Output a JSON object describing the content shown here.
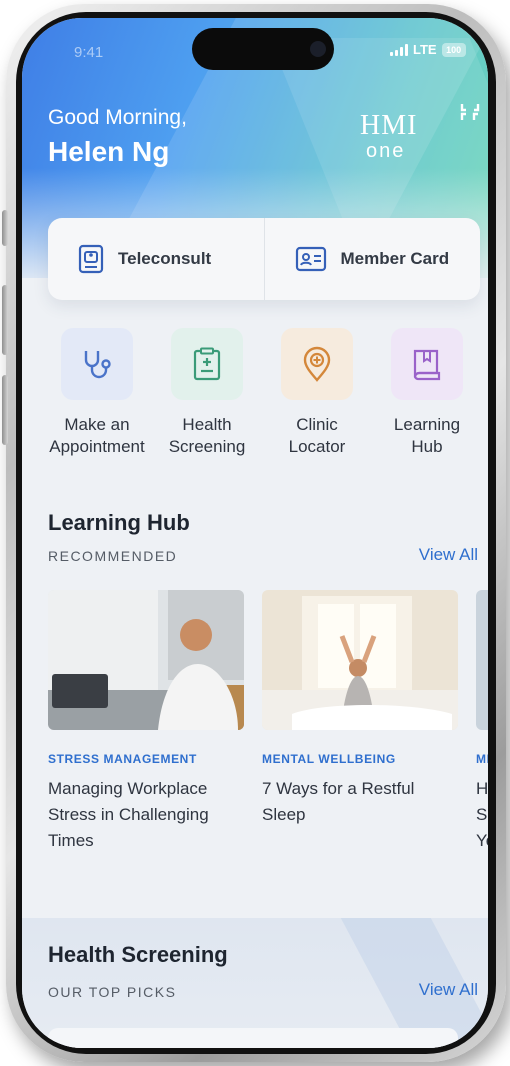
{
  "status_bar": {
    "time": "9:41",
    "network": "LTE",
    "battery": "100"
  },
  "header": {
    "greeting": "Good Morning,",
    "user_name": "Helen Ng",
    "logo_main": "HMI",
    "logo_sub": "one"
  },
  "quick_actions": [
    {
      "label": "Teleconsult",
      "icon": "badge-id-icon"
    },
    {
      "label": "Member Card",
      "icon": "member-card-icon"
    }
  ],
  "services": [
    {
      "label": "Make an\nAppointment",
      "icon": "stethoscope-icon",
      "tile_color": "#e3e9f7",
      "icon_color": "#4a73c9"
    },
    {
      "label": "Health\nScreening",
      "icon": "clipboard-icon",
      "tile_color": "#e2f1ec",
      "icon_color": "#3a9b78"
    },
    {
      "label": "Clinic\nLocator",
      "icon": "location-pin-icon",
      "tile_color": "#f6ebde",
      "icon_color": "#d4873a"
    },
    {
      "label": "Learning\nHub",
      "icon": "book-icon",
      "tile_color": "#efe6f7",
      "icon_color": "#9a62c9"
    }
  ],
  "learning_hub": {
    "title": "Learning Hub",
    "subtitle": "RECOMMENDED",
    "view_all": "View All",
    "articles": [
      {
        "category": "STRESS MANAGEMENT",
        "title": "Managing Workplace Stress in Challenging Times"
      },
      {
        "category": "MENTAL WELLBEING",
        "title": "7 Ways for a Restful Sleep"
      },
      {
        "category": "MEN",
        "title": "How Sup You"
      }
    ]
  },
  "health_screening": {
    "title": "Health Screening",
    "subtitle": "OUR TOP PICKS",
    "view_all": "View All"
  }
}
